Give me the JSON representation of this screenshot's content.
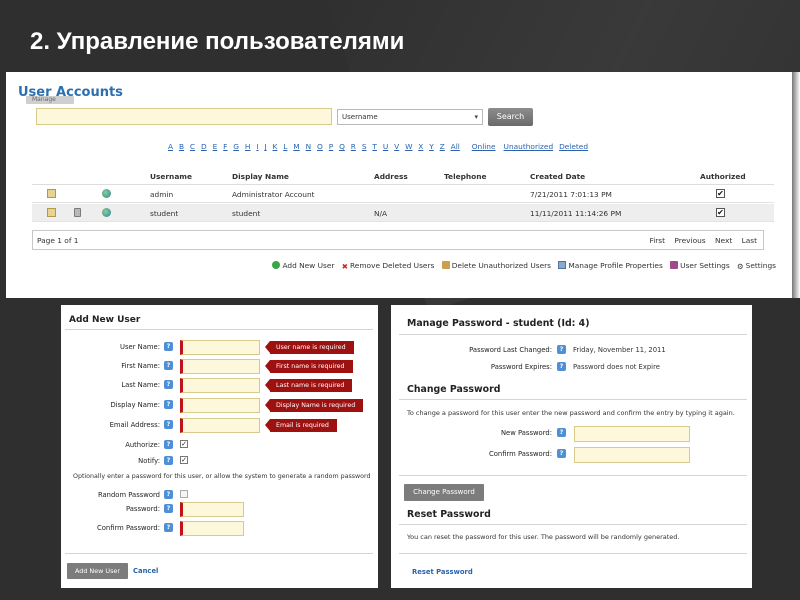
{
  "slide": {
    "title": "2. Управление пользователями"
  },
  "user_accounts": {
    "title": "User Accounts",
    "manage_label": "Manage",
    "search": {
      "value": "",
      "field_select": "Username",
      "button": "Search"
    },
    "alphabet": [
      "A",
      "B",
      "C",
      "D",
      "E",
      "F",
      "G",
      "H",
      "I",
      "J",
      "K",
      "L",
      "M",
      "N",
      "O",
      "P",
      "Q",
      "R",
      "S",
      "T",
      "U",
      "V",
      "W",
      "X",
      "Y",
      "Z",
      "All"
    ],
    "filters": [
      "Online",
      "Unauthorized",
      "Deleted"
    ],
    "columns": [
      "Username",
      "Display Name",
      "Address",
      "Telephone",
      "Created Date",
      "Authorized"
    ],
    "rows": [
      {
        "username": "admin",
        "display_name": "Administrator Account",
        "address": "",
        "telephone": "",
        "created": "7/21/2011 7:01:13 PM",
        "authorized": "✔"
      },
      {
        "username": "student",
        "display_name": "student",
        "address": "N/A",
        "telephone": "",
        "created": "11/11/2011 11:14:26 PM",
        "authorized": "✔"
      }
    ],
    "pager": {
      "label": "Page 1 of 1",
      "first": "First",
      "previous": "Previous",
      "next": "Next",
      "last": "Last"
    },
    "actions": [
      "Add New User",
      "Remove Deleted Users",
      "Delete Unauthorized Users",
      "Manage Profile Properties",
      "User Settings",
      "Settings"
    ]
  },
  "add_user": {
    "title": "Add New User",
    "fields": [
      {
        "label": "User Name:",
        "error": "User name is required"
      },
      {
        "label": "First Name:",
        "error": "First name is required"
      },
      {
        "label": "Last Name:",
        "error": "Last name is required"
      },
      {
        "label": "Display Name:",
        "error": "Display Name is required"
      },
      {
        "label": "Email Address:",
        "error": "Email is required"
      }
    ],
    "authorize_label": "Authorize:",
    "notify_label": "Notify:",
    "note": "Optionally enter a password for this user, or allow the system to generate a random password",
    "random_password_label": "Random Password",
    "password_label": "Password:",
    "confirm_password_label": "Confirm Password:",
    "add_button": "Add New User",
    "cancel": "Cancel"
  },
  "manage_password": {
    "title": "Manage Password - student (Id: 4)",
    "last_changed_label": "Password Last Changed:",
    "last_changed_value": "Friday, November 11, 2011",
    "expires_label": "Password Expires:",
    "expires_value": "Password does not Expire",
    "change_section": "Change Password",
    "change_text": "To change a password for this user enter the new password and confirm the entry by typing it again.",
    "new_password_label": "New Password:",
    "confirm_password_label": "Confirm Password:",
    "change_button": "Change Password",
    "reset_section": "Reset Password",
    "reset_text": "You can reset the password for this user. The password will be randomly generated.",
    "reset_link": "Reset Password"
  }
}
